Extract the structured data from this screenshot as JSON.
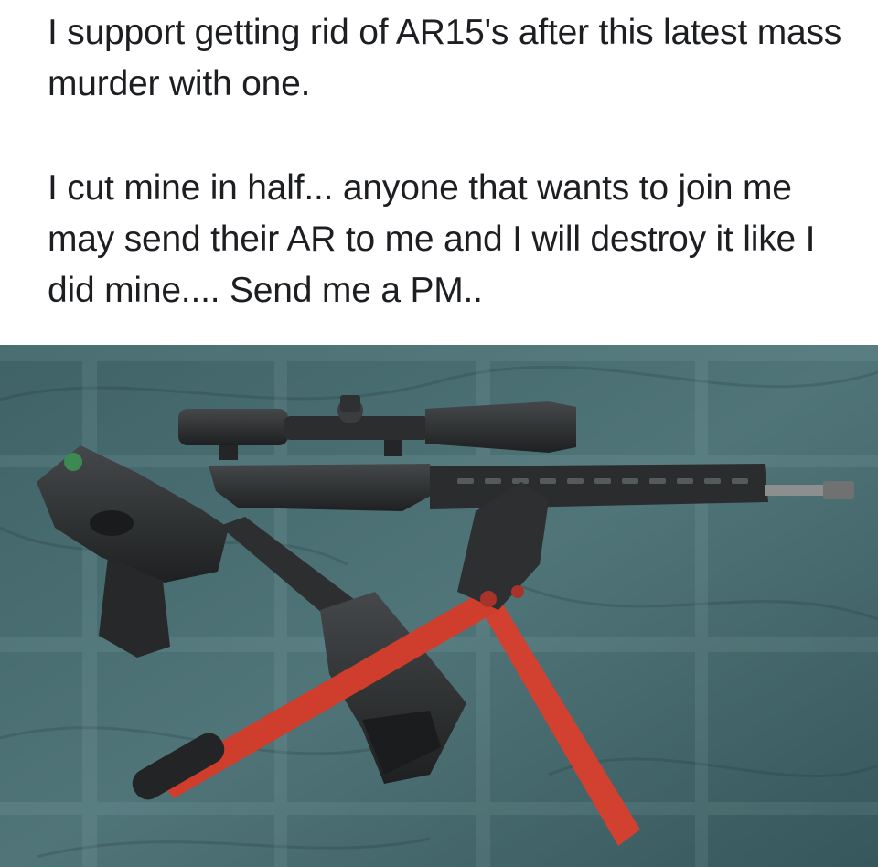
{
  "post": {
    "paragraphs": [
      "I support getting rid of AR15's after this latest mass murder with one.",
      "I cut mine in half... anyone that wants to join me may send their AR to me and I will destroy it like I did mine.... Send me a PM.."
    ]
  },
  "photo": {
    "subjects": [
      "rifle-upper-icon",
      "scope-icon",
      "lower-receiver-icon",
      "stock-icon",
      "bolt-cutter-icon"
    ],
    "colors": {
      "bedsheet": "#4b6f72",
      "bedsheet_dark": "#2f4d52",
      "gun_metal": "#2a2c2d",
      "cutter_red": "#d2402f"
    }
  }
}
